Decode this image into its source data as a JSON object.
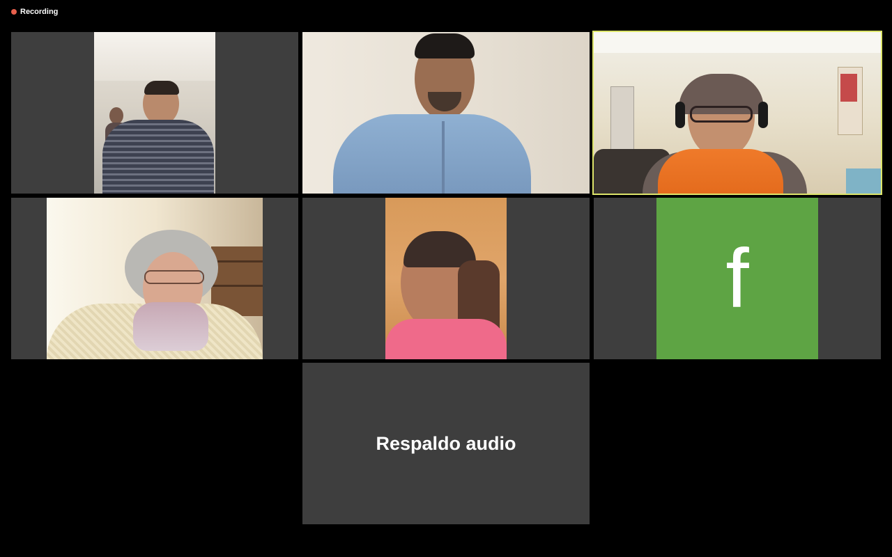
{
  "recording": {
    "label": "Recording",
    "dot_color": "#e8604c"
  },
  "participants": [
    {
      "kind": "video",
      "description_icon": "man-striped-sweater"
    },
    {
      "kind": "video",
      "description_icon": "man-blue-shirt"
    },
    {
      "kind": "video",
      "description_icon": "woman-headset-orange-scarf",
      "active_speaker": true
    },
    {
      "kind": "video",
      "description_icon": "older-woman-glasses"
    },
    {
      "kind": "video",
      "description_icon": "woman-pink-shirt"
    },
    {
      "kind": "avatar",
      "letter": "f",
      "color": "#5ea444"
    },
    {
      "kind": "name",
      "name": "Respaldo audio"
    }
  ],
  "colors": {
    "active_speaker_border": "#dde56a",
    "tile_background": "#3e3e3e",
    "avatar_green": "#5ea444"
  }
}
